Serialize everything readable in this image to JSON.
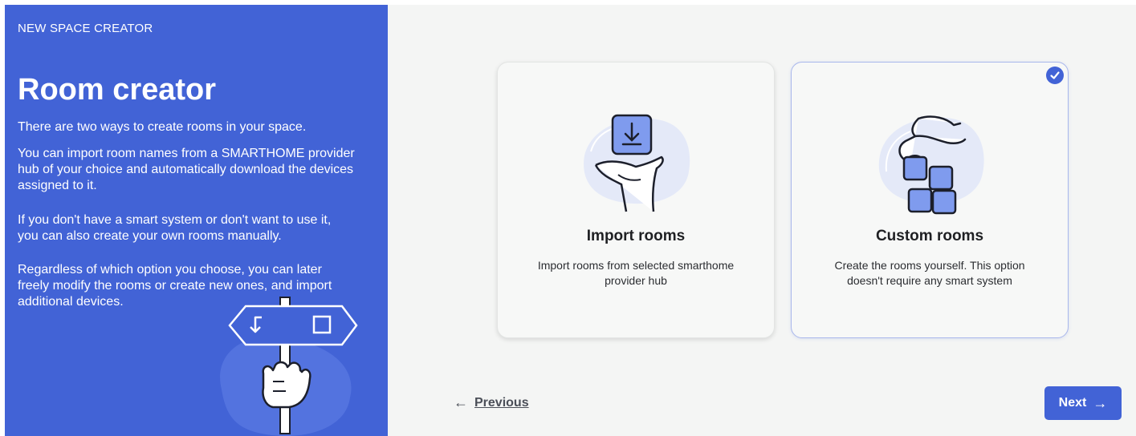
{
  "sidebar": {
    "eyebrow": "NEW SPACE CREATOR",
    "title": "Room creator",
    "paragraphs": [
      "There are two ways to create rooms in your space.",
      "You can import room names from a SMARTHOME provider hub of your choice and automatically download the devices assigned to it.",
      "If you don't have a smart system or don't want to use it, you can also create your own rooms manually.",
      "Regardless of which option you choose, you can later freely modify the rooms or create new ones, and import additional devices."
    ],
    "illustration_icon": "signpost-hand-icon"
  },
  "options": [
    {
      "title": "Import rooms",
      "description": "Import rooms from selected smarthome provider hub",
      "icon": "hand-download-icon",
      "selected": false
    },
    {
      "title": "Custom rooms",
      "description": "Create the rooms yourself. This option doesn't require any smart system",
      "icon": "hand-blocks-icon",
      "selected": true
    }
  ],
  "nav": {
    "previous_label": "Previous",
    "previous_icon": "arrow-left-icon",
    "next_label": "Next",
    "next_icon": "arrow-right-icon"
  },
  "colors": {
    "accent": "#4263d6",
    "sidebar_bg": "#4263d6",
    "main_bg": "#f4f5f4",
    "selected_border": "#a9b7ec"
  }
}
